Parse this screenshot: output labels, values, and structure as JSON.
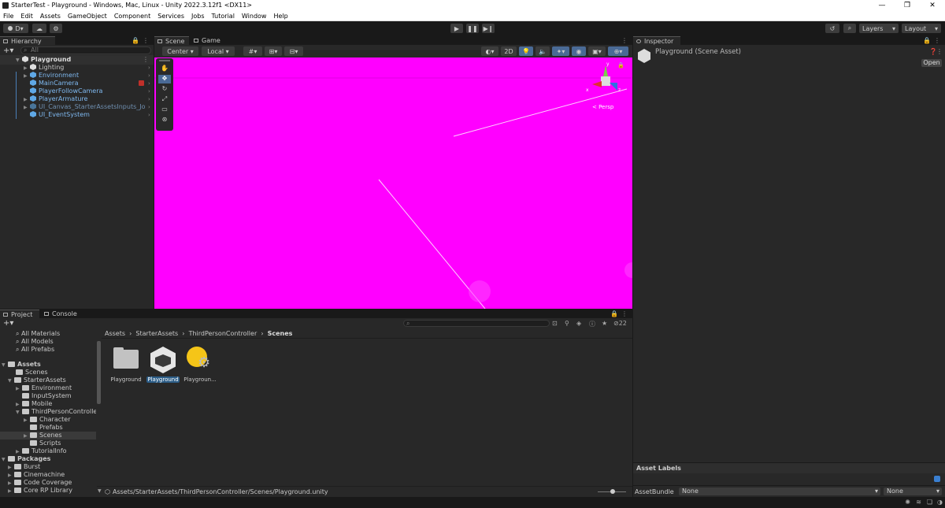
{
  "window": {
    "title": "StarterTest - Playground - Windows, Mac, Linux - Unity 2022.3.12f1 <DX11>",
    "minimize": "—",
    "maximize": "❐",
    "close": "✕"
  },
  "menu": [
    "File",
    "Edit",
    "Assets",
    "GameObject",
    "Component",
    "Services",
    "Jobs",
    "Tutorial",
    "Window",
    "Help"
  ],
  "toolbar": {
    "account": "D",
    "layers": "Layers",
    "layout": "Layout"
  },
  "hierarchy": {
    "tab": "Hierarchy",
    "search_placeholder": "All",
    "root": "Playground",
    "items": [
      {
        "label": "Lighting",
        "icon": "light-icon"
      },
      {
        "label": "Environment",
        "icon": "prefab-icon"
      },
      {
        "label": "MainCamera",
        "icon": "prefab-icon"
      },
      {
        "label": "PlayerFollowCamera",
        "icon": "prefab-icon"
      },
      {
        "label": "PlayerArmature",
        "icon": "prefab-icon"
      },
      {
        "label": "UI_Canvas_StarterAssetsInputs_Joystic",
        "icon": "prefab-icon"
      },
      {
        "label": "UI_EventSystem",
        "icon": "prefab-icon"
      }
    ]
  },
  "scene": {
    "tabs": [
      "Scene",
      "Game"
    ],
    "pivot": "Center",
    "space": "Local",
    "mode2d": "2D",
    "persp": "< Persp",
    "axis_y": "y",
    "axis_x": "x",
    "axis_z": "z",
    "background_color": "#ff00ff"
  },
  "inspector": {
    "tab": "Inspector",
    "title": "Playground (Scene Asset)",
    "open": "Open",
    "asset_labels": "Asset Labels",
    "asset_bundle_label": "AssetBundle",
    "asset_bundle_value": "None",
    "asset_variant_value": "None"
  },
  "project": {
    "tabs": [
      "Project",
      "Console"
    ],
    "favorites": [
      "All Materials",
      "All Models",
      "All Prefabs"
    ],
    "tree": [
      {
        "label": "Assets",
        "level": 0,
        "bold": true
      },
      {
        "label": "Scenes",
        "level": 1
      },
      {
        "label": "StarterAssets",
        "level": 1
      },
      {
        "label": "Environment",
        "level": 2
      },
      {
        "label": "InputSystem",
        "level": 2
      },
      {
        "label": "Mobile",
        "level": 2
      },
      {
        "label": "ThirdPersonController",
        "level": 2
      },
      {
        "label": "Character",
        "level": 3
      },
      {
        "label": "Prefabs",
        "level": 3
      },
      {
        "label": "Scenes",
        "level": 3
      },
      {
        "label": "Scripts",
        "level": 3
      },
      {
        "label": "TutorialInfo",
        "level": 2
      },
      {
        "label": "Packages",
        "level": 0,
        "bold": true
      },
      {
        "label": "Burst",
        "level": 1
      },
      {
        "label": "Cinemachine",
        "level": 1
      },
      {
        "label": "Code Coverage",
        "level": 1
      },
      {
        "label": "Core RP Library",
        "level": 1
      }
    ],
    "breadcrumb": [
      "Assets",
      "StarterAssets",
      "ThirdPersonController",
      "Scenes"
    ],
    "assets": [
      {
        "label": "Playground",
        "type": "folder"
      },
      {
        "label": "Playground",
        "type": "scene"
      },
      {
        "label": "Playgroun...",
        "type": "lighting"
      }
    ],
    "hidden_count": "22",
    "path": "Assets/StarterAssets/ThirdPersonController/Scenes/Playground.unity"
  }
}
